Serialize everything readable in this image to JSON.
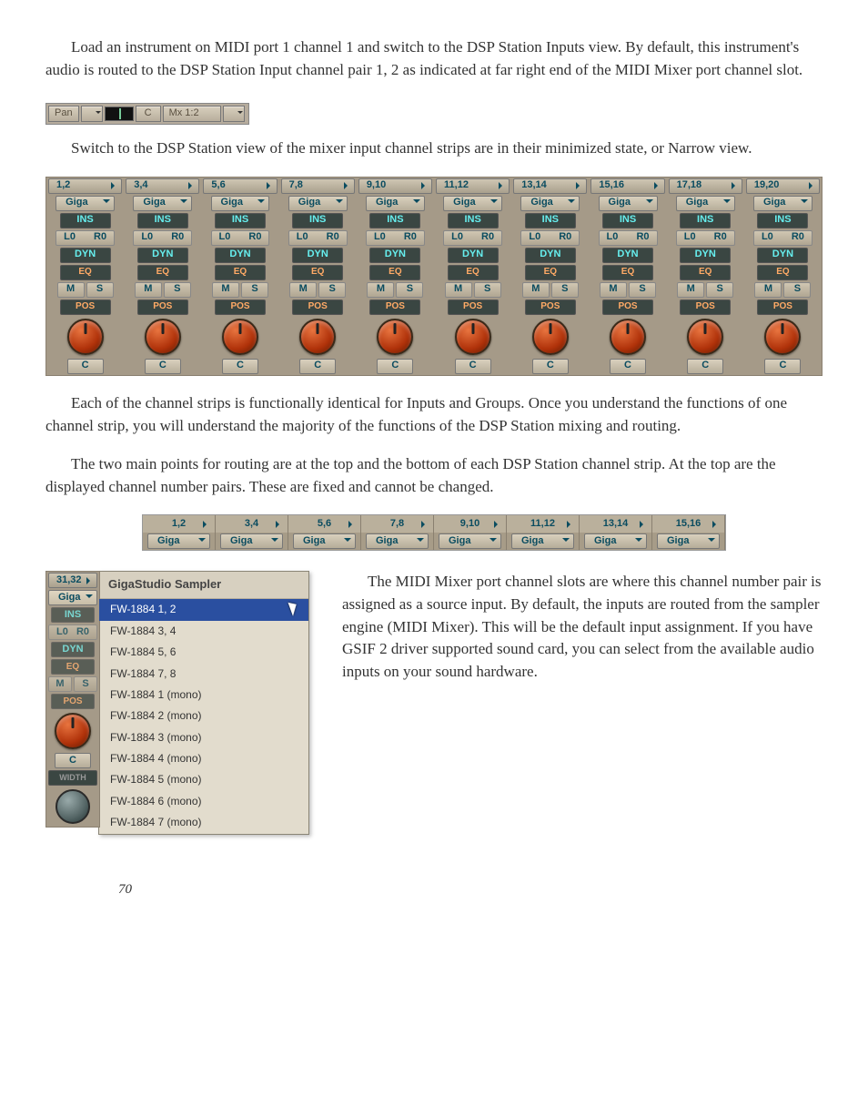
{
  "para1": "Load an instrument on MIDI port 1 channel 1 and switch to the DSP Station Inputs view. By default, this instrument's audio is routed to the DSP Station Input channel pair 1, 2 as indicated at far right end of the MIDI Mixer port channel slot.",
  "panbar": {
    "pan": "Pan",
    "c": "C",
    "mx": "Mx 1:2"
  },
  "para2": "Switch to the DSP Station view of the mixer input channel strips are in their minimized state, or Narrow view.",
  "mixer": {
    "pairs": [
      "1,2",
      "3,4",
      "5,6",
      "7,8",
      "9,10",
      "11,12",
      "13,14",
      "15,16",
      "17,18",
      "19,20"
    ],
    "giga": "Giga",
    "ins": "INS",
    "lr_left": "L0",
    "lr_right": "R0",
    "dyn": "DYN",
    "eq": "EQ",
    "m": "M",
    "s": "S",
    "pos": "POS",
    "c": "C"
  },
  "para3": "Each of the channel strips is functionally identical for Inputs and Groups. Once you understand the functions of one channel strip, you will understand the majority of the functions of the DSP Station mixing and routing.",
  "para4": "The two main points for routing are at the top and the bottom of each DSP Station channel strip. At the top are the displayed channel number pairs. These are fixed and cannot be changed.",
  "pairstrip": {
    "pairs": [
      "1,2",
      "3,4",
      "5,6",
      "7,8",
      "9,10",
      "11,12",
      "13,14",
      "15,16"
    ],
    "giga": "Giga"
  },
  "ministrip": {
    "pair": "31,32"
  },
  "menu": {
    "title": "GigaStudio Sampler",
    "items": [
      "FW-1884  1, 2",
      "FW-1884  3, 4",
      "FW-1884  5, 6",
      "FW-1884  7, 8",
      "FW-1884  1 (mono)",
      "FW-1884  2 (mono)",
      "FW-1884  3 (mono)",
      "FW-1884  4 (mono)",
      "FW-1884  5 (mono)",
      "FW-1884  6 (mono)",
      "FW-1884  7 (mono)"
    ],
    "selected_index": 0
  },
  "width": "WIDTH",
  "para5": "The MIDI Mixer port channel slots are where this channel number pair is assigned as a source input. By default, the inputs are routed from the sampler engine (MIDI Mixer). This will be the default input assignment. If you have GSIF 2 driver supported sound card, you can select from the available audio inputs on your sound hardware.",
  "page": "70"
}
